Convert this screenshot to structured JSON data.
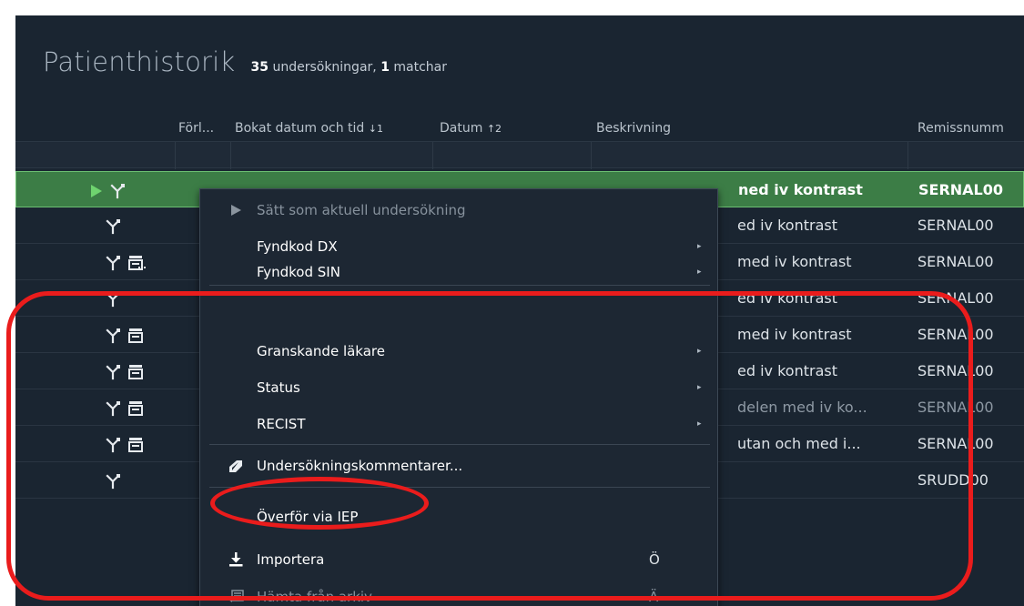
{
  "header": {
    "title": "Patienthistorik",
    "count": "35",
    "count_label": "undersökningar,",
    "match_count": "1",
    "match_label": "matchar"
  },
  "columns": {
    "forl": "Förl...",
    "booked": "Bokat datum och tid",
    "booked_sort": "↓1",
    "date": "Datum",
    "date_sort": "↑2",
    "description": "Beskrivning",
    "remiss": "Remissnumm"
  },
  "rows": [
    {
      "desc": "ned iv kontrast",
      "remiss": "SERNAL00",
      "selected": true,
      "icons": [
        "play-icon",
        "tree-icon"
      ]
    },
    {
      "desc": "ed iv kontrast",
      "remiss": "SERNAL00",
      "icons": [
        "tree-icon"
      ]
    },
    {
      "desc": "med iv kontrast",
      "remiss": "SERNAL00",
      "icons": [
        "tree-icon",
        "document-more-icon"
      ]
    },
    {
      "desc": "ed iv kontrast",
      "remiss": "SERNAL00",
      "icons": [
        "tree-icon"
      ]
    },
    {
      "desc": "med iv kontrast",
      "remiss": "SERNAL00",
      "icons": [
        "tree-icon",
        "document-icon"
      ]
    },
    {
      "desc": "ed iv kontrast",
      "remiss": "SERNAL00",
      "icons": [
        "tree-icon",
        "document-icon"
      ]
    },
    {
      "desc": "delen med iv ko...",
      "remiss": "SERNAL00",
      "dim": true,
      "icons": [
        "tree-icon",
        "document-icon"
      ]
    },
    {
      "desc": "utan och med i...",
      "remiss": "SERNAL00",
      "icons": [
        "tree-icon",
        "document-icon"
      ]
    },
    {
      "desc": "",
      "remiss": "SRUDD00",
      "icons": [
        "tree-icon"
      ]
    }
  ],
  "menu": {
    "set_current": "Sätt som aktuell undersökning",
    "fyndkod_dx": "Fyndkod DX",
    "fyndkod_sin": "Fyndkod SIN",
    "granskande": "Granskande läkare",
    "status": "Status",
    "recist": "RECIST",
    "comments": "Undersökningskommentarer...",
    "transfer": "Överför via IEP",
    "import": "Importera",
    "import_shortcut": "Ö",
    "fetch_archive": "Hämta från arkiv",
    "fetch_shortcut": "Ä",
    "submenu_arrow": "▸"
  },
  "colors": {
    "background": "#1a2531",
    "selected_row": "#3c7d46",
    "annotation": "#ea1c1c",
    "play": "#6fd36f"
  }
}
